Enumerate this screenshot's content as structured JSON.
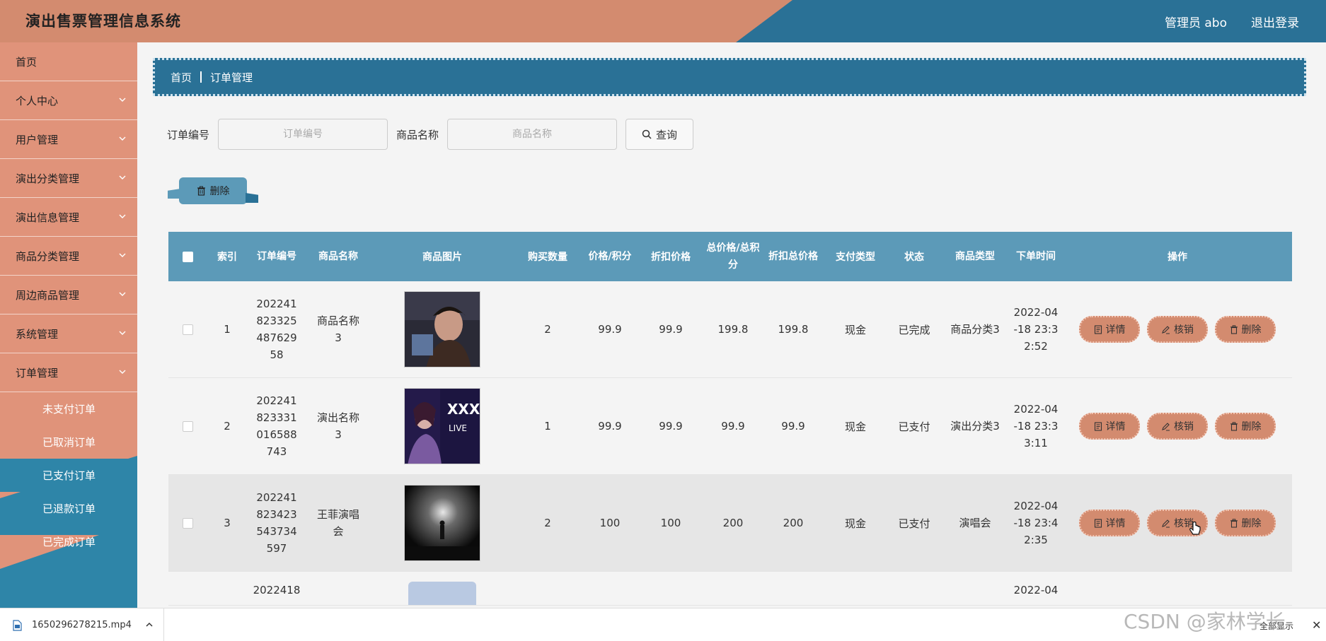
{
  "header": {
    "title": "演出售票管理信息系统",
    "admin_label": "管理员 abo",
    "logout_label": "退出登录"
  },
  "sidebar": {
    "items": [
      {
        "label": "首页",
        "has_children": false
      },
      {
        "label": "个人中心",
        "has_children": true
      },
      {
        "label": "用户管理",
        "has_children": true
      },
      {
        "label": "演出分类管理",
        "has_children": true
      },
      {
        "label": "演出信息管理",
        "has_children": true
      },
      {
        "label": "商品分类管理",
        "has_children": true
      },
      {
        "label": "周边商品管理",
        "has_children": true
      },
      {
        "label": "系统管理",
        "has_children": true
      },
      {
        "label": "订单管理",
        "has_children": true
      }
    ],
    "sub_items": [
      "未支付订单",
      "已取消订单",
      "已支付订单",
      "已退款订单",
      "已完成订单"
    ],
    "active_sub": "已支付订单"
  },
  "breadcrumb": {
    "home": "首页",
    "current": "订单管理"
  },
  "search": {
    "order_no_label": "订单编号",
    "order_no_placeholder": "订单编号",
    "order_no_value": "",
    "product_name_label": "商品名称",
    "product_name_placeholder": "商品名称",
    "product_name_value": "",
    "query_label": "查询"
  },
  "batch_delete_label": "删除",
  "table": {
    "headers": [
      "索引",
      "订单编号",
      "商品名称",
      "商品图片",
      "购买数量",
      "价格/积分",
      "折扣价格",
      "总价格/总积分",
      "折扣总价格",
      "支付类型",
      "状态",
      "商品类型",
      "下单时间",
      "操作"
    ],
    "rows": [
      {
        "index": "1",
        "order_no": "20224182332548762958",
        "name": "商品名称3",
        "qty": "2",
        "price": "99.9",
        "discount_price": "99.9",
        "total": "199.8",
        "discount_total": "199.8",
        "pay_type": "现金",
        "status": "已完成",
        "type": "商品分类3",
        "time": "2022-04-18 23:32:52",
        "image": "portrait-dark"
      },
      {
        "index": "2",
        "order_no": "20224182333101658874​3",
        "name": "演出名称3",
        "qty": "1",
        "price": "99.9",
        "discount_price": "99.9",
        "total": "99.9",
        "discount_total": "99.9",
        "pay_type": "现金",
        "status": "已支付",
        "type": "演出分类3",
        "time": "2022-04-18 23:33:11",
        "image": "concert-poster"
      },
      {
        "index": "3",
        "order_no": "20224182342354373459​7",
        "name": "王菲演唱会",
        "qty": "2",
        "price": "100",
        "discount_price": "100",
        "total": "200",
        "discount_total": "200",
        "pay_type": "现金",
        "status": "已支付",
        "type": "演唱会",
        "time": "2022-04-18 23:42:35",
        "image": "stage-light"
      }
    ],
    "partial_row": {
      "order_no_start": "2022418",
      "time_start": "2022-04"
    }
  },
  "row_actions": {
    "detail": "详情",
    "verify": "核销",
    "delete": "删除"
  },
  "downloads": {
    "file": "1650296278215.mp4",
    "show_all": "全部显示"
  },
  "watermark": "CSDN @家林学长",
  "colors": {
    "peach": "#d38b6f",
    "teal": "#2a7196",
    "table_header": "#5c9ab8"
  }
}
